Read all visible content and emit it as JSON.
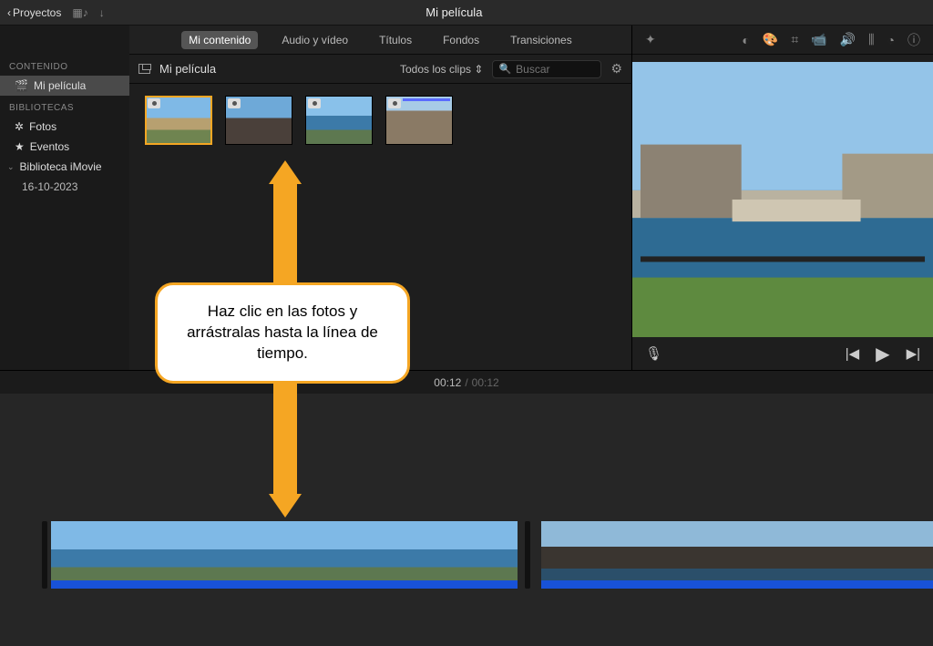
{
  "titlebar": {
    "back_label": "Proyectos",
    "project_title": "Mi película"
  },
  "tabs": {
    "my_content": "Mi contenido",
    "audio_video": "Audio y vídeo",
    "titles": "Títulos",
    "backgrounds": "Fondos",
    "transitions": "Transiciones"
  },
  "sidebar": {
    "section_content": "CONTENIDO",
    "my_movie": "Mi película",
    "section_libraries": "BIBLIOTECAS",
    "photos": "Fotos",
    "events": "Eventos",
    "imovie_library": "Biblioteca iMovie",
    "date_event": "16-10-2023"
  },
  "mediabar": {
    "title": "Mi película",
    "filter_label": "Todos los clips",
    "search_placeholder": "Buscar"
  },
  "time": {
    "current": "00:12",
    "total": "00:12"
  },
  "callout": {
    "text": "Haz clic en las fotos y arrástralas hasta la línea de tiempo."
  },
  "icons": {
    "back_chevron": "‹",
    "download": "↓",
    "filter_updown": "⇕",
    "search": "🔍",
    "gear": "⚙",
    "wand": "✦",
    "color_balance": "◐",
    "color_correct": "🎨",
    "crop": "⌗",
    "stabilize": "📹",
    "volume": "🔊",
    "equalizer": "⫼",
    "speed": "◔",
    "info": "ⓘ",
    "mic": "🎙",
    "prev": "|◀",
    "play": "▶",
    "next": "▶|",
    "photos_icon": "✲",
    "star": "★",
    "clapper": "🎬"
  }
}
